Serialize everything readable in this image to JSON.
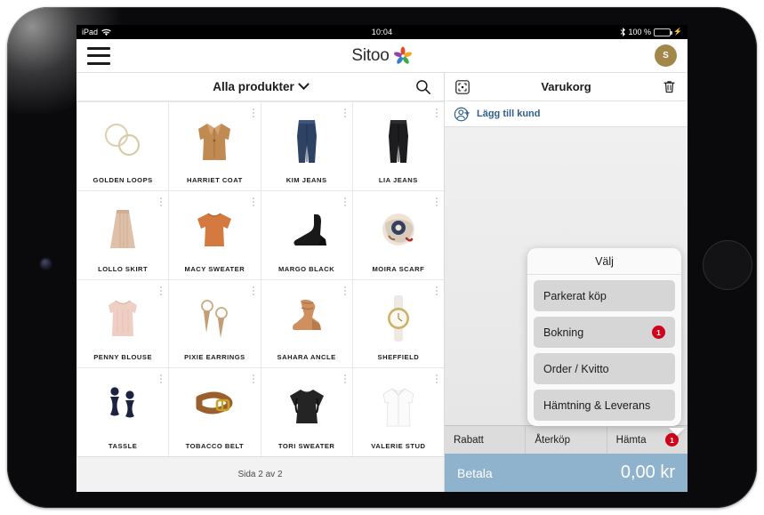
{
  "status_bar": {
    "device": "iPad",
    "wifi_icon": "wifi-icon",
    "time": "10:04",
    "bluetooth_icon": "bluetooth-icon",
    "battery_percent": "100 %",
    "battery_icon": "battery-full-icon",
    "charging_icon": "charging-bolt-icon"
  },
  "app_bar": {
    "menu_icon": "hamburger-menu-icon",
    "brand_name": "Sitoo",
    "brand_logo_icon": "sitoo-star-logo-icon",
    "avatar_initial": "S",
    "avatar_color": "#a3874a"
  },
  "products": {
    "filter_label": "Alla produkter",
    "filter_chevron_icon": "chevron-down-icon",
    "search_icon": "search-icon",
    "kebab_icon": "more-vertical-icon",
    "pager_text": "Sida 2 av 2",
    "items": [
      {
        "name": "GOLDEN LOOPS",
        "thumb": "gold-hoop-earrings"
      },
      {
        "name": "HARRIET COAT",
        "thumb": "camel-coat"
      },
      {
        "name": "KIM JEANS",
        "thumb": "blue-jeans"
      },
      {
        "name": "LIA JEANS",
        "thumb": "black-jeans"
      },
      {
        "name": "LOLLO SKIRT",
        "thumb": "beige-pleated-skirt"
      },
      {
        "name": "MACY SWEATER",
        "thumb": "orange-sweater"
      },
      {
        "name": "MARGO BLACK",
        "thumb": "black-heeled-boot"
      },
      {
        "name": "MOIRA SCARF",
        "thumb": "patterned-silk-scarf"
      },
      {
        "name": "PENNY BLOUSE",
        "thumb": "pink-sleeveless-blouse"
      },
      {
        "name": "PIXIE EARRINGS",
        "thumb": "tassel-drop-earrings"
      },
      {
        "name": "SAHARA ANCLE",
        "thumb": "tan-ruffle-boot"
      },
      {
        "name": "SHEFFIELD",
        "thumb": "gold-wristwatch"
      },
      {
        "name": "TASSLE",
        "thumb": "navy-tassel-earrings"
      },
      {
        "name": "TOBACCO BELT",
        "thumb": "brown-leather-belt"
      },
      {
        "name": "TORI SWEATER",
        "thumb": "black-ruffle-sweater"
      },
      {
        "name": "VALERIE STUD",
        "thumb": "white-shirt"
      }
    ]
  },
  "cart": {
    "scan_icon": "scan-barcode-icon",
    "title": "Varukorg",
    "trash_icon": "trash-icon",
    "add_customer_icon": "add-person-icon",
    "add_customer_label": "Lägg till kund",
    "actions": [
      {
        "label": "Rabatt",
        "badge": null
      },
      {
        "label": "Återköp",
        "badge": null
      },
      {
        "label": "Hämta",
        "badge": "1"
      }
    ],
    "pay_label": "Betala",
    "pay_amount": "0,00 kr",
    "pay_color": "#8fb3cc"
  },
  "popover": {
    "title": "Välj",
    "items": [
      {
        "label": "Parkerat köp",
        "badge": null
      },
      {
        "label": "Bokning",
        "badge": "1"
      },
      {
        "label": "Order / Kvitto",
        "badge": null
      },
      {
        "label": "Hämtning & Leverans",
        "badge": null
      }
    ],
    "badge_color": "#d0021b"
  }
}
